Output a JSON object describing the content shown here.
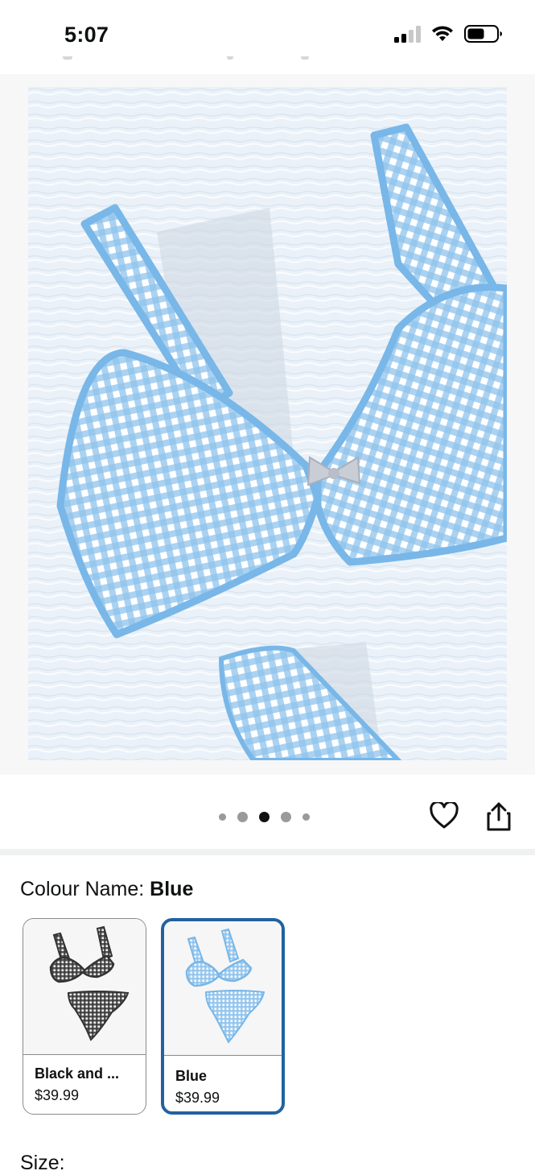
{
  "status_bar": {
    "time": "5:07",
    "icons": [
      "cellular-signal-icon",
      "wifi-icon",
      "battery-icon"
    ]
  },
  "gallery": {
    "image": "blue-gingham-bikini-top-photo",
    "dots_count": 5,
    "active_index": 2,
    "actions": [
      "heart-icon",
      "share-icon"
    ]
  },
  "colour": {
    "label": "Colour Name: ",
    "selected": "Blue",
    "options": [
      {
        "name": "Black and ...",
        "price": "$39.99",
        "selected": false,
        "color": "#3a3a3a"
      },
      {
        "name": "Blue",
        "price": "$39.99",
        "selected": true,
        "color": "#9ec9ea"
      }
    ]
  },
  "size": {
    "label": "Size: "
  },
  "colors": {
    "accent": "#2162a1",
    "gingham_blue": "#8fc3ec",
    "trim_blue": "#78b7e8"
  }
}
